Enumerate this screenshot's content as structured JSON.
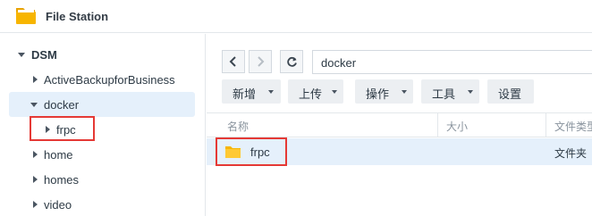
{
  "app": {
    "title": "File Station",
    "icon": "file-station-folder-icon",
    "accent": "#f5b400"
  },
  "sidebar": {
    "root": {
      "label": "DSM",
      "expanded": true
    },
    "items": [
      {
        "label": "ActiveBackupforBusiness",
        "expanded": false
      },
      {
        "label": "docker",
        "expanded": true,
        "selected": true
      },
      {
        "label": "frpc",
        "expanded": false,
        "child_of": "docker"
      },
      {
        "label": "home",
        "expanded": false
      },
      {
        "label": "homes",
        "expanded": false
      },
      {
        "label": "video",
        "expanded": false
      }
    ]
  },
  "navigation": {
    "back": "chevron-left-icon",
    "forward": "chevron-right-icon",
    "refresh": "refresh-icon",
    "path": "docker"
  },
  "toolbar": {
    "buttons": [
      {
        "label": "新增",
        "dropdown": true
      },
      {
        "label": "上传",
        "dropdown": true
      },
      {
        "label": "操作",
        "dropdown": true
      },
      {
        "label": "工具",
        "dropdown": true
      },
      {
        "label": "设置",
        "dropdown": false
      }
    ]
  },
  "file_list": {
    "columns": [
      "名称",
      "大小",
      "文件类型"
    ],
    "rows": [
      {
        "name": "frpc",
        "size": "",
        "type": "文件夹",
        "icon": "folder-icon",
        "selected": true
      }
    ]
  },
  "highlight_color": "#e53935",
  "selection_color": "#e5f0fb"
}
